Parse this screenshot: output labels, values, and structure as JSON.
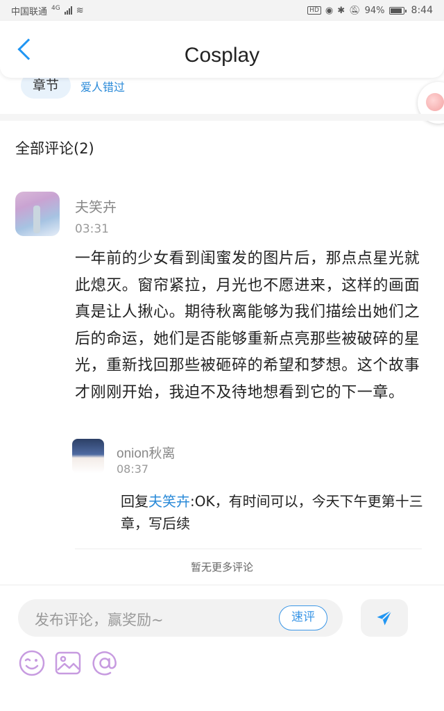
{
  "status": {
    "carrier": "中国联通",
    "network": "4G",
    "battery": "94%",
    "time": "8:44"
  },
  "header": {
    "title": "Cosplay"
  },
  "chapter": {
    "pill": "章节",
    "link": "爱人错过"
  },
  "comments_header": "全部评论(2)",
  "comment": {
    "user": "夫笑卉",
    "time": "03:31",
    "body": "一年前的少女看到闺蜜发的图片后，那点点星光就此熄灭。窗帘紧拉，月光也不愿进来，这样的画面真是让人揪心。期待秋离能够为我们描绘出她们之后的命运，她们是否能够重新点亮那些被破碎的星光，重新找回那些被砸碎的希望和梦想。这个故事才刚刚开始，我迫不及待地想看到它的下一章。"
  },
  "reply": {
    "user": "onion秋离",
    "time": "08:37",
    "prefix": "回复",
    "mention": "夫笑卉",
    "text": ":OK，有时间可以，今天下午更第十三章，写后续"
  },
  "no_more": "暂无更多评论",
  "input": {
    "placeholder": "发布评论，赢奖励~",
    "quick_label": "速评"
  },
  "colors": {
    "accent": "#2196f3",
    "link": "#2a8ad8",
    "emoji": "#c79be0"
  },
  "icons": [
    "back-arrow-icon",
    "send-icon",
    "emoji-icon",
    "image-icon",
    "at-icon"
  ]
}
